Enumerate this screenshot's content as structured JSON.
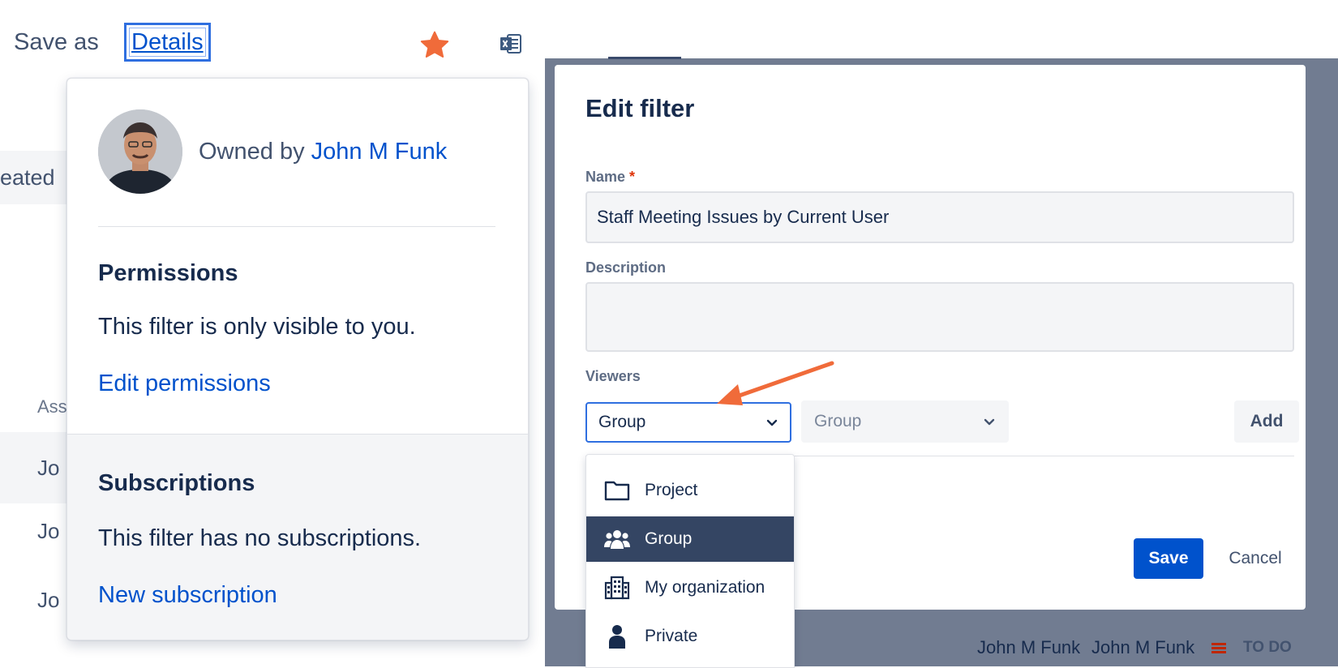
{
  "toolbar": {
    "save_as_label": "Save as",
    "details_label": "Details",
    "star_icon": "star-icon",
    "excel_icon": "excel-export-icon",
    "star_color": "#f06b3a"
  },
  "background_table": {
    "created_header": "eated",
    "assignee_header": "Ass",
    "rows": [
      "Jo",
      "Jo",
      "Jo"
    ]
  },
  "details_popover": {
    "owned_by_prefix": "Owned by",
    "owner_name": "John M Funk",
    "permissions_heading": "Permissions",
    "permissions_text": "This filter is only visible to you.",
    "edit_permissions_link": "Edit permissions",
    "subscriptions_heading": "Subscriptions",
    "subscriptions_text": "This filter has no subscriptions.",
    "new_subscription_link": "New subscription"
  },
  "edit_filter": {
    "title": "Edit filter",
    "name_label": "Name",
    "required_mark": "*",
    "name_value": "Staff Meeting Issues by Current User",
    "description_label": "Description",
    "description_value": "",
    "viewers_label": "Viewers",
    "viewer_type_selected": "Group",
    "viewer_group_placeholder": "Group",
    "add_label": "Add",
    "save_label": "Save",
    "cancel_label": "Cancel",
    "viewer_type_options": [
      {
        "label": "Project",
        "icon": "folder-icon",
        "selected": false
      },
      {
        "label": "Group",
        "icon": "group-icon",
        "selected": true
      },
      {
        "label": "My organization",
        "icon": "building-icon",
        "selected": false
      },
      {
        "label": "Private",
        "icon": "person-icon",
        "selected": false
      }
    ]
  },
  "background_footer": {
    "assignee": "John M Funk",
    "reporter": "John M Funk",
    "status": "TO DO"
  },
  "colors": {
    "primary": "#0052cc",
    "overlay": "#717c91",
    "selected_menu": "#344563",
    "annotation_arrow": "#f06b3a"
  }
}
